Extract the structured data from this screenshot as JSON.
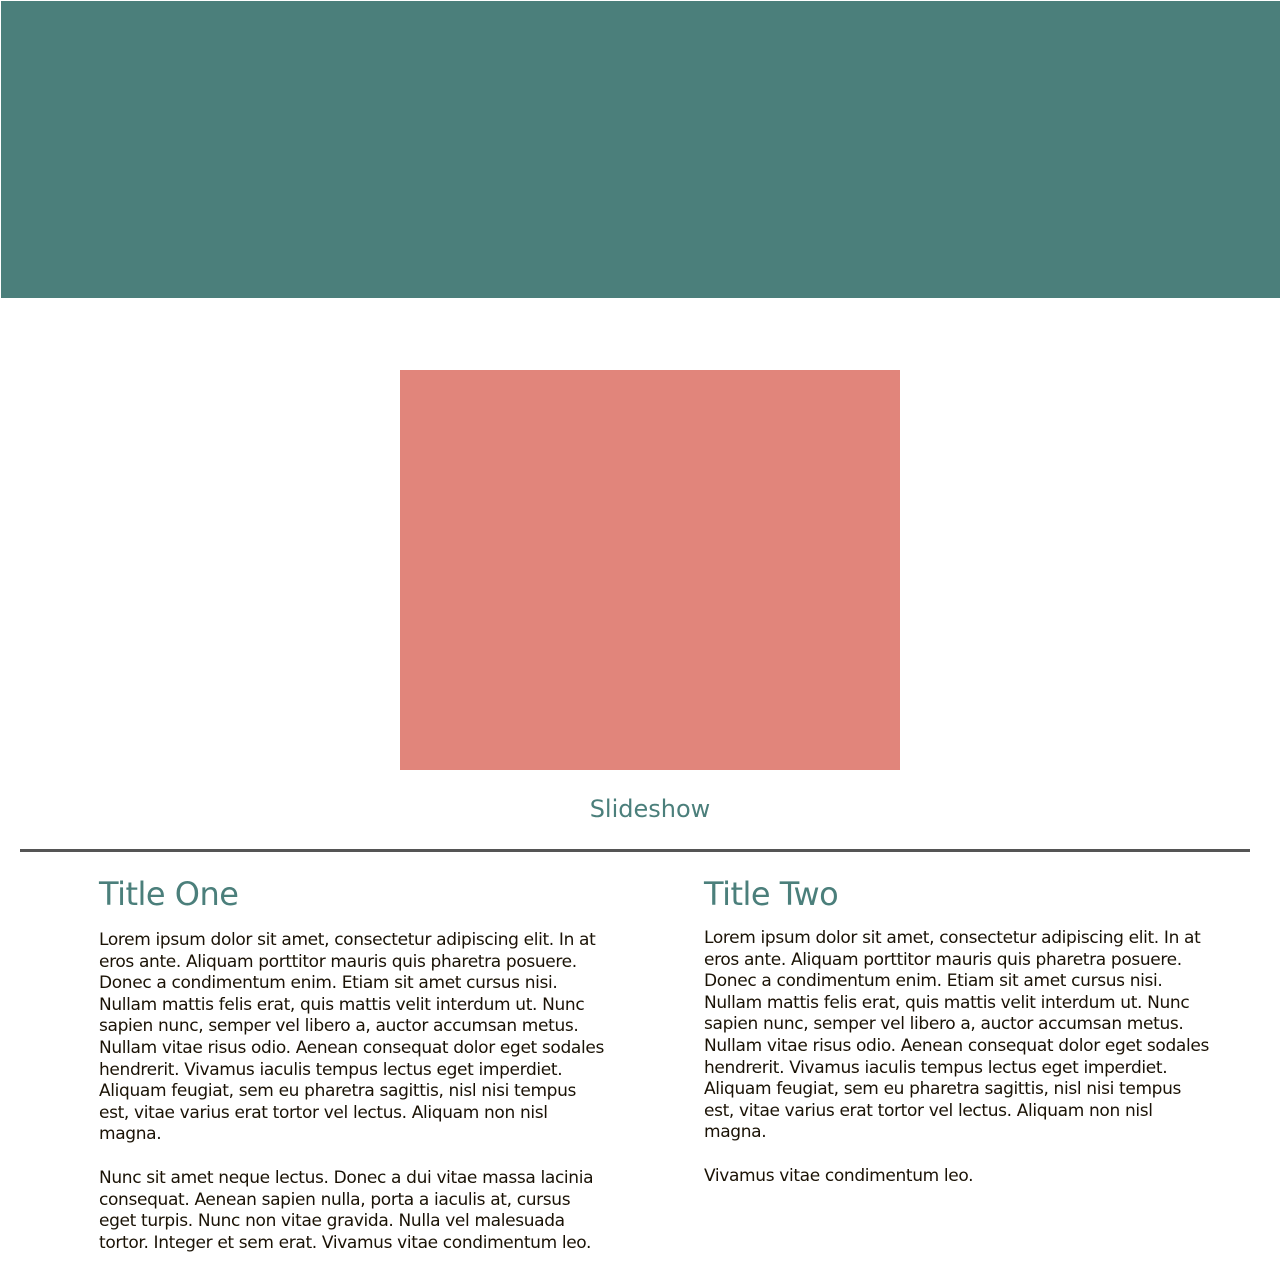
{
  "colors": {
    "header_banner": "#4b7f7b",
    "slideshow_image": "#e1857b",
    "accent_text": "#4b7f7b",
    "body_text": "#1a1205",
    "divider": "#555555"
  },
  "slideshow": {
    "caption": "Slideshow"
  },
  "columns": [
    {
      "title": "Title One",
      "paragraphs": [
        "Lorem ipsum dolor sit amet, consectetur adipiscing elit. In at eros ante. Aliquam porttitor mauris quis pharetra posuere. Donec a condimentum enim. Etiam sit amet cursus nisi. Nullam mattis felis erat, quis mattis velit interdum ut. Nunc sapien nunc, semper vel libero a, auctor accumsan metus. Nullam vitae risus odio. Aenean consequat dolor eget sodales hendrerit. Vivamus iaculis tempus lectus eget imperdiet. Aliquam feugiat, sem eu pharetra sagittis, nisl nisi tempus est, vitae varius erat tortor vel lectus. Aliquam non nisl magna.",
        "Nunc sit amet neque lectus. Donec a dui vitae massa lacinia consequat. Aenean sapien nulla, porta a iaculis at, cursus eget turpis. Nunc non vitae gravida. Nulla vel malesuada tortor. Integer et sem erat. Vivamus vitae condimentum leo."
      ]
    },
    {
      "title": "Title Two",
      "paragraphs": [
        "Lorem ipsum dolor sit amet, consectetur adipiscing elit. In at eros ante. Aliquam porttitor mauris quis pharetra posuere. Donec a condimentum enim. Etiam sit amet cursus nisi. Nullam mattis felis erat, quis mattis velit interdum ut. Nunc sapien nunc, semper vel libero a, auctor accumsan metus. Nullam vitae risus odio. Aenean consequat dolor eget sodales hendrerit. Vivamus iaculis tempus lectus eget imperdiet. Aliquam feugiat, sem eu pharetra sagittis, nisl nisi tempus est, vitae varius erat tortor vel lectus. Aliquam non nisl magna.",
        "Vivamus vitae condimentum leo."
      ]
    }
  ]
}
